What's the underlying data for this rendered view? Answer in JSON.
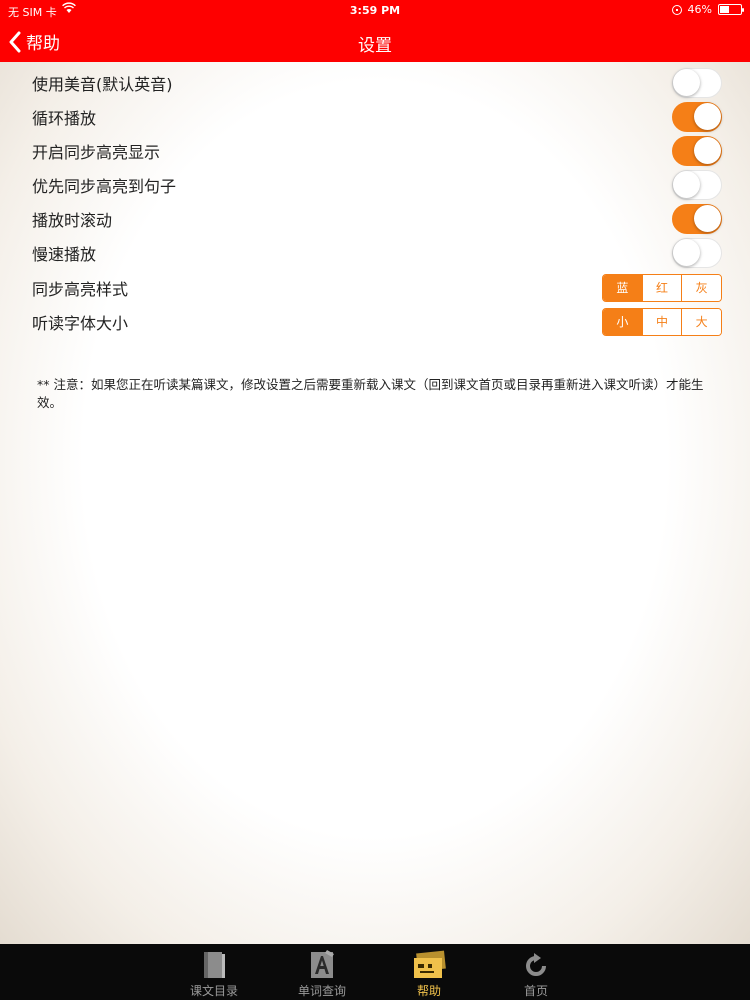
{
  "status_bar": {
    "carrier": "无 SIM 卡",
    "time": "3:59 PM",
    "battery": "46%",
    "battery_level": 0.46
  },
  "nav": {
    "back_label": "帮助",
    "title": "设置"
  },
  "settings": {
    "toggles": [
      {
        "label": "使用美音(默认英音)",
        "on": false
      },
      {
        "label": "循环播放",
        "on": true
      },
      {
        "label": "开启同步高亮显示",
        "on": true
      },
      {
        "label": "优先同步高亮到句子",
        "on": false
      },
      {
        "label": "播放时滚动",
        "on": true
      },
      {
        "label": "慢速播放",
        "on": false
      }
    ],
    "highlight_style": {
      "label": "同步高亮样式",
      "options": [
        "蓝",
        "红",
        "灰"
      ],
      "selected": "蓝"
    },
    "font_size": {
      "label": "听读字体大小",
      "options": [
        "小",
        "中",
        "大"
      ],
      "selected": "小"
    },
    "note": "** 注意：如果您正在听读某篇课文，修改设置之后需要重新载入课文（回到课文首页或目录再重新进入课文听读）才能生效。"
  },
  "tabbar": {
    "tabs": [
      {
        "label": "课文目录",
        "icon": "book-icon",
        "active": false
      },
      {
        "label": "单词查询",
        "icon": "dictionary-icon",
        "active": false
      },
      {
        "label": "帮助",
        "icon": "help-cards-icon",
        "active": true
      },
      {
        "label": "首页",
        "icon": "refresh-icon",
        "active": false
      }
    ]
  },
  "colors": {
    "nav_bg": "#fe0000",
    "accent": "#f57f17",
    "tab_active": "#f0c14b",
    "tabbar_bg": "#0a0a0a"
  }
}
